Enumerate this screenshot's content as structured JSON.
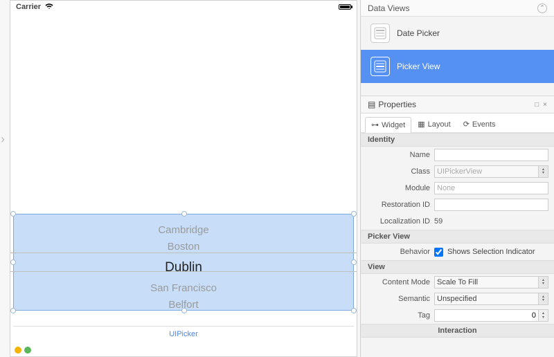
{
  "statusbar": {
    "carrier": "Carrier",
    "wifi": "􀙇"
  },
  "picker": {
    "items": [
      "Cambridge",
      "Boston",
      "Dublin",
      "San Francisco",
      "Belfort"
    ],
    "selected_index": 2,
    "label": "UIPicker"
  },
  "data_views": {
    "title": "Data Views",
    "items": [
      {
        "label": "Date Picker"
      },
      {
        "label": "Picker View"
      }
    ]
  },
  "properties": {
    "title": "Properties",
    "tabs": {
      "widget": "Widget",
      "layout": "Layout",
      "events": "Events"
    },
    "identity": {
      "title": "Identity",
      "name_label": "Name",
      "name": "",
      "class_label": "Class",
      "class": "UIPickerView",
      "module_label": "Module",
      "module": "None",
      "restoration_label": "Restoration ID",
      "restoration": "",
      "localization_label": "Localization ID",
      "localization": "59"
    },
    "pickerview": {
      "title": "Picker View",
      "behavior_label": "Behavior",
      "shows_si": "Shows Selection Indicator",
      "shows_si_checked": true
    },
    "view": {
      "title": "View",
      "content_mode_label": "Content Mode",
      "content_mode": "Scale To Fill",
      "semantic_label": "Semantic",
      "semantic": "Unspecified",
      "tag_label": "Tag",
      "tag": "0"
    },
    "interaction": {
      "title": "Interaction"
    }
  }
}
